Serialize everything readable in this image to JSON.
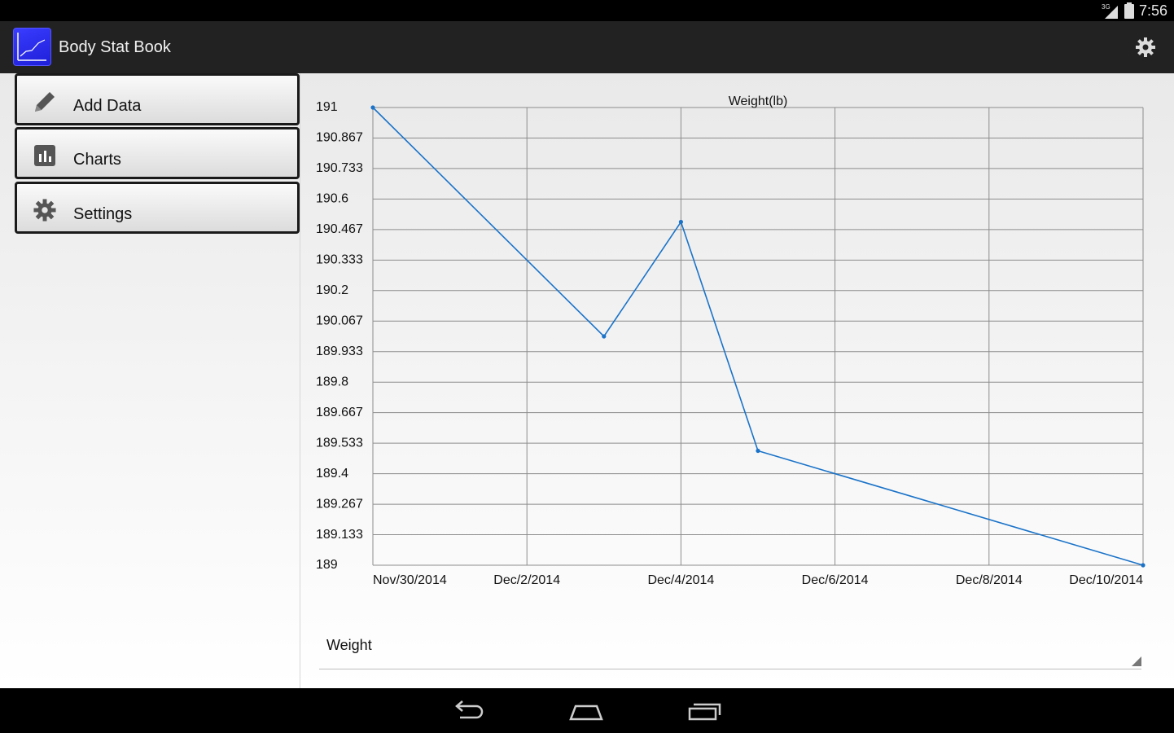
{
  "status_bar": {
    "time": "7:56",
    "network": "3G"
  },
  "app": {
    "title": "Body Stat Book",
    "icon": "line-chart-app-icon"
  },
  "sidebar": {
    "items": [
      {
        "label": "Add Data",
        "icon": "pencil-icon"
      },
      {
        "label": "Charts",
        "icon": "bar-chart-icon"
      },
      {
        "label": "Settings",
        "icon": "gear-icon"
      }
    ]
  },
  "chart_data": {
    "type": "line",
    "title": "Weight(lb)",
    "x": [
      "Nov/30/2014",
      "Dec/3/2014",
      "Dec/4/2014",
      "Dec/5/2014",
      "Dec/10/2014"
    ],
    "series": [
      {
        "values": [
          191,
          190.0,
          190.5,
          189.5,
          189
        ],
        "color": "#1a73c9"
      }
    ],
    "x_tick_labels": [
      "Nov/30/2014",
      "Dec/2/2014",
      "Dec/4/2014",
      "Dec/6/2014",
      "Dec/8/2014",
      "Dec/10/2014"
    ],
    "y_tick_labels": [
      "191",
      "190.867",
      "190.733",
      "190.6",
      "190.467",
      "190.333",
      "190.2",
      "190.067",
      "189.933",
      "189.8",
      "189.667",
      "189.533",
      "189.4",
      "189.267",
      "189.133",
      "189"
    ],
    "xlim": [
      "Nov/30/2014",
      "Dec/10/2014"
    ],
    "ylim": [
      189,
      191
    ],
    "grid": true
  },
  "spinner": {
    "value": "Weight"
  },
  "colors": {
    "line": "#1a73c9",
    "action_bar": "#222222",
    "grid": "#8c8c8c"
  }
}
